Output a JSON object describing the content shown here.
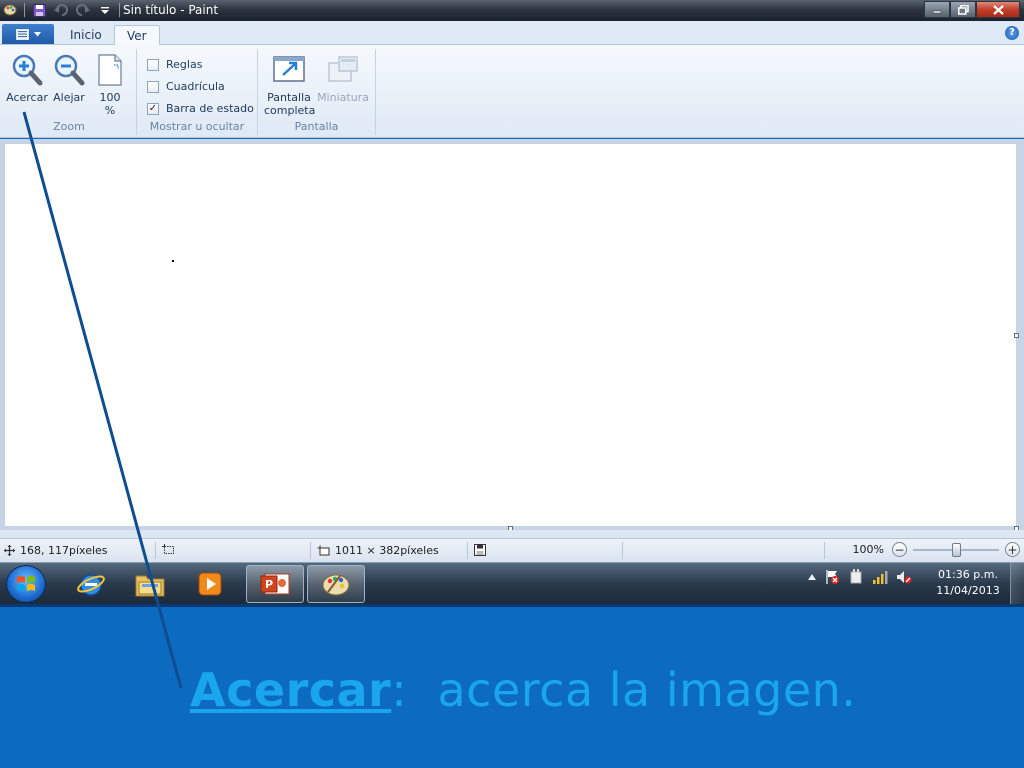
{
  "window": {
    "title": "Sin título - Paint"
  },
  "ribbon": {
    "tabs": [
      {
        "label": "Inicio",
        "active": false
      },
      {
        "label": "Ver",
        "active": true
      }
    ],
    "groups": {
      "zoom": {
        "label": "Zoom",
        "zoom_in": {
          "label": "Acercar",
          "icon": "zoom-in-icon"
        },
        "zoom_out": {
          "label": "Alejar",
          "icon": "zoom-out-icon"
        },
        "actual_size": {
          "label_line1": "100",
          "label_line2": "%",
          "icon": "page-icon"
        }
      },
      "show_hide": {
        "label": "Mostrar u ocultar",
        "rulers": {
          "label": "Reglas",
          "checked": false
        },
        "gridlines": {
          "label": "Cuadrícula",
          "checked": false
        },
        "status_bar": {
          "label": "Barra de estado",
          "checked": true
        }
      },
      "display": {
        "label": "Pantalla",
        "fullscreen": {
          "label_line1": "Pantalla",
          "label_line2": "completa",
          "icon": "fullscreen-icon"
        },
        "thumbnail": {
          "label": "Miniatura",
          "icon": "thumbnail-icon",
          "enabled": false
        }
      }
    }
  },
  "statusbar": {
    "cursor_position": "168, 117píxeles",
    "selection_size": "",
    "canvas_size": "1011 × 382píxeles",
    "zoom_level": "100%",
    "zoom_fraction": 0.5
  },
  "taskbar": {
    "clock_time": "01:36 p.m.",
    "clock_date": "11/04/2013",
    "pinned": [
      "internet-explorer-icon",
      "windows-explorer-icon",
      "media-player-icon",
      "powerpoint-icon",
      "paint-icon"
    ]
  },
  "slide": {
    "keyword": "Acercar",
    "separator": ":",
    "description": "  acerca la imagen."
  },
  "colors": {
    "slide_background": "#0d6bbf",
    "caption_text": "#1aa6ee",
    "pointer_line": "#0e4d8f"
  }
}
